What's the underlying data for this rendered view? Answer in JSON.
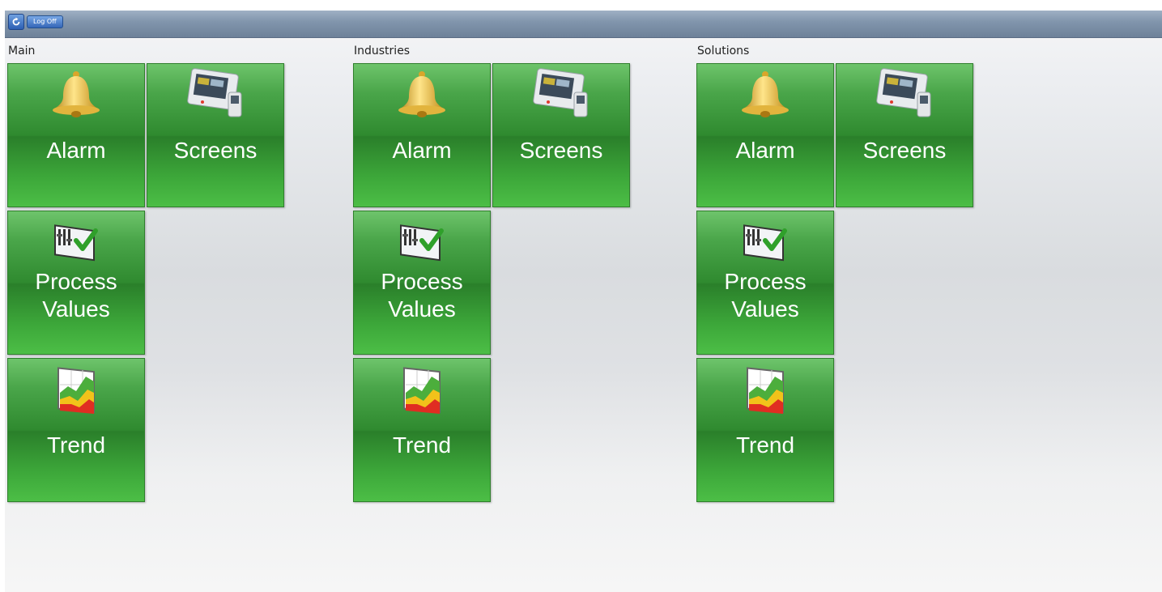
{
  "toolbar": {
    "logoff_label": "Log Off"
  },
  "groups": [
    {
      "label": "Main",
      "tiles": {
        "alarm": "Alarm",
        "screens": "Screens",
        "process_l1": "Process",
        "process_l2": "Values",
        "trend": "Trend"
      }
    },
    {
      "label": "Industries",
      "tiles": {
        "alarm": "Alarm",
        "screens": "Screens",
        "process_l1": "Process",
        "process_l2": "Values",
        "trend": "Trend"
      }
    },
    {
      "label": "Solutions",
      "tiles": {
        "alarm": "Alarm",
        "screens": "Screens",
        "process_l1": "Process",
        "process_l2": "Values",
        "trend": "Trend"
      }
    }
  ],
  "icons": {
    "alarm": "bell-icon",
    "screens": "hmi-panel-icon",
    "process": "process-values-icon",
    "trend": "trend-chart-icon"
  },
  "colors": {
    "tile_green": "#3c9a3a",
    "topbar": "#8296ad"
  }
}
